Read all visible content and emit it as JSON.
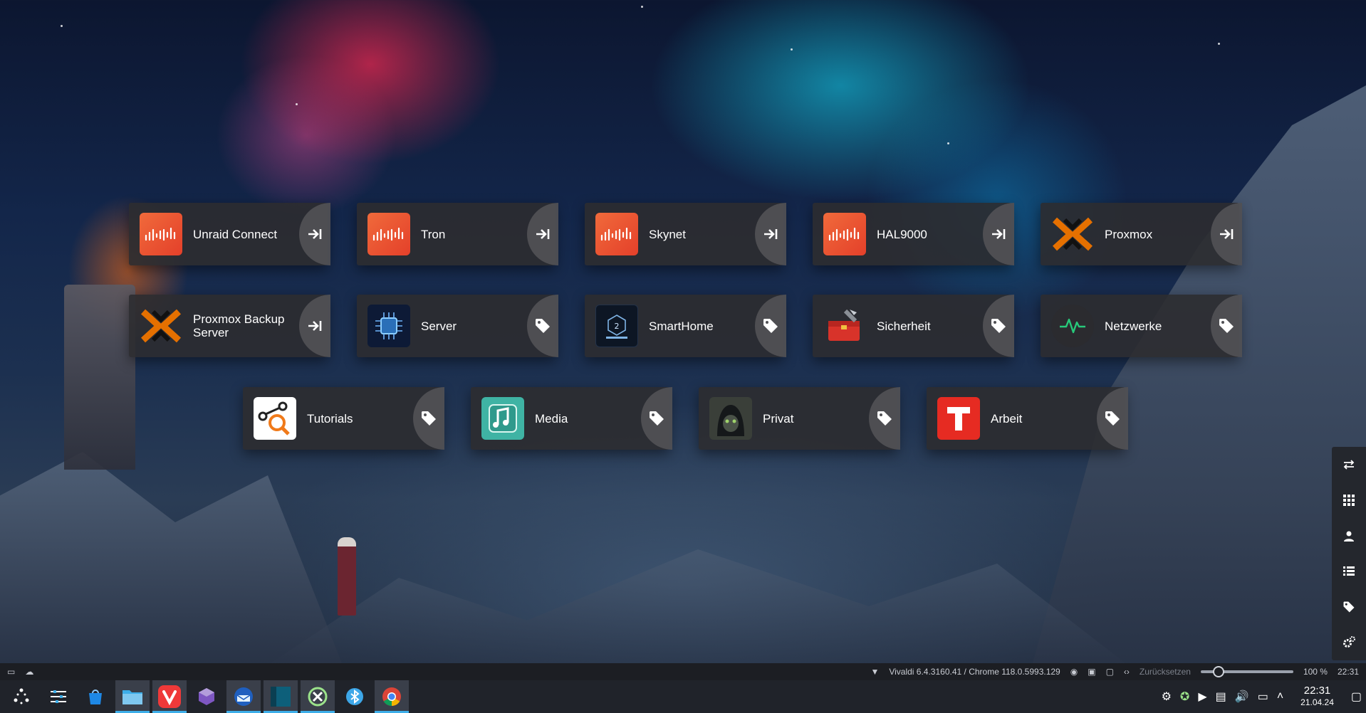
{
  "dials": [
    {
      "label": "Unraid Connect",
      "icon": "unraid-logo",
      "action": "open-link"
    },
    {
      "label": "Tron",
      "icon": "unraid-logo",
      "action": "open-link"
    },
    {
      "label": "Skynet",
      "icon": "unraid-logo",
      "action": "open-link"
    },
    {
      "label": "HAL9000",
      "icon": "unraid-logo",
      "action": "open-link"
    },
    {
      "label": "Proxmox",
      "icon": "proxmox-logo",
      "action": "open-link"
    },
    {
      "label": "Proxmox Backup Server",
      "icon": "proxmox-logo",
      "action": "open-link"
    },
    {
      "label": "Server",
      "icon": "chip-image",
      "action": "tag"
    },
    {
      "label": "SmartHome",
      "icon": "technik-image",
      "action": "tag"
    },
    {
      "label": "Sicherheit",
      "icon": "toolbox-image",
      "action": "tag"
    },
    {
      "label": "Netzwerke",
      "icon": "pulse-image",
      "action": "tag"
    },
    {
      "label": "Tutorials",
      "icon": "magnifier-image",
      "action": "tag"
    },
    {
      "label": "Media",
      "icon": "music-image",
      "action": "tag"
    },
    {
      "label": "Privat",
      "icon": "hooded-cat-image",
      "action": "tag"
    },
    {
      "label": "Arbeit",
      "icon": "letter-t-image",
      "action": "tag"
    }
  ],
  "side_panel": [
    "sync-icon",
    "grid-icon",
    "user-icon",
    "list-icon",
    "tag-icon",
    "settings-icon"
  ],
  "statusbar": {
    "version": "Vivaldi 6.4.3160.41 / Chrome 118.0.5993.129",
    "reset": "Zurücksetzen",
    "zoom": "100 %",
    "time": "22:31",
    "zoom_fraction": 0.15
  },
  "taskbar": {
    "apps": [
      "launcher-icon",
      "settings-icon",
      "store-icon",
      "file-manager-icon",
      "vivaldi-icon",
      "copilot-icon",
      "thunderbird-icon",
      "terminal-icon",
      "xnview-icon",
      "bluetooth-icon",
      "chrome-icon"
    ],
    "time": "22:31",
    "date": "21.04.24"
  }
}
